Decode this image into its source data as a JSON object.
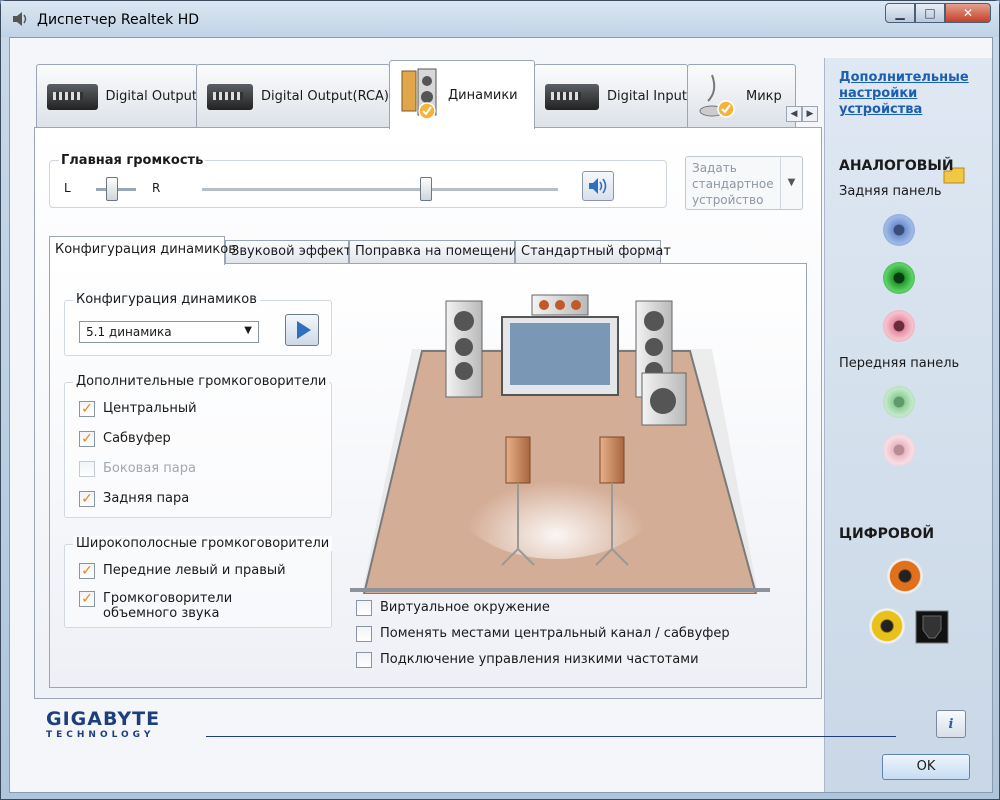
{
  "window": {
    "title": "Диспетчер Realtek HD",
    "minimize": "▁",
    "maximize": "□",
    "close": "✕"
  },
  "top_tabs": [
    {
      "label": "Digital Output",
      "icon": "digital-device-icon"
    },
    {
      "label": "Digital Output(RCA)",
      "icon": "digital-device-icon"
    },
    {
      "label": "Динамики",
      "icon": "speakers-icon",
      "active": true
    },
    {
      "label": "Digital Input",
      "icon": "digital-device-icon"
    },
    {
      "label": "Микр",
      "icon": "microphone-icon"
    }
  ],
  "tab_scroll": {
    "left": "◀",
    "right": "▶"
  },
  "main_volume": {
    "title": "Главная громкость",
    "left_label": "L",
    "right_label": "R"
  },
  "default_device": {
    "label": "Задать стандартное устройство",
    "arrow": "▼"
  },
  "inner_tabs": [
    {
      "label": "Конфигурация динамиков",
      "active": true
    },
    {
      "label": "Звуковой эффект"
    },
    {
      "label": "Поправка на помещение"
    },
    {
      "label": "Стандартный формат"
    }
  ],
  "speaker_config": {
    "title": "Конфигурация динамиков",
    "selected": "5.1 динамика",
    "arrow": "▼"
  },
  "additional": {
    "title": "Дополнительные громкоговорители",
    "items": [
      {
        "label": "Центральный",
        "checked": true,
        "disabled": false
      },
      {
        "label": "Сабвуфер",
        "checked": true,
        "disabled": false
      },
      {
        "label": "Боковая пара",
        "checked": false,
        "disabled": true
      },
      {
        "label": "Задняя пара",
        "checked": true,
        "disabled": false
      }
    ]
  },
  "wideband": {
    "title": "Широкополосные громкоговорители",
    "items": [
      {
        "label": "Передние левый и правый",
        "checked": true
      },
      {
        "label": "Громкоговорители объемного звука",
        "checked": true
      }
    ]
  },
  "options": [
    {
      "label": "Виртуальное окружение",
      "checked": false
    },
    {
      "label": "Поменять местами центральный канал / сабвуфер",
      "checked": false
    },
    {
      "label": "Подключение управления низкими частотами",
      "checked": false
    }
  ],
  "check_mark": "✓",
  "side": {
    "link": "Дополнительные настройки устройства",
    "analog_title": "АНАЛОГОВЫЙ",
    "back_panel": "Задняя панель",
    "front_panel": "Передняя панель",
    "digital_title": "ЦИФРОВОЙ",
    "colors": {
      "blue": "#6f8fcf",
      "green": "#1f9a2b",
      "pink": "#e48ca0",
      "green_faded": "#8fcf9a",
      "pink_faded": "#eab8c4",
      "orange": "#e0701c",
      "yellow": "#e8c11a"
    }
  },
  "footer": {
    "logo": "GIGABYTE",
    "logo_sub": "TECHNOLOGY",
    "info": "i",
    "ok": "OK"
  }
}
